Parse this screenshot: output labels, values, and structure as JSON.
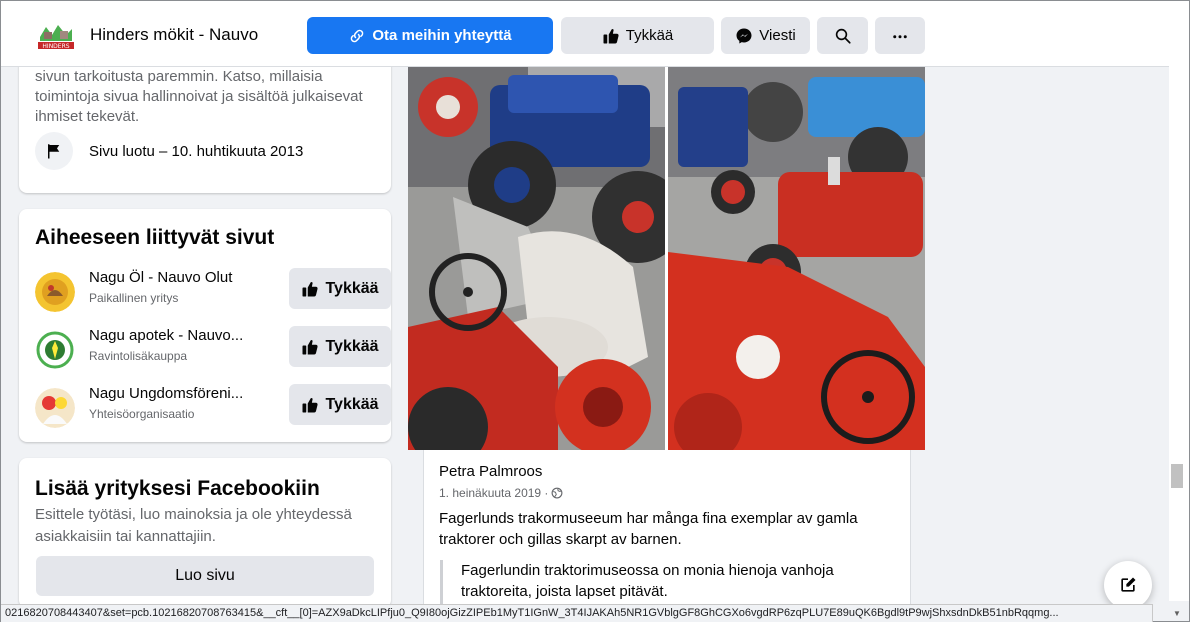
{
  "header": {
    "page_name": "Hinders mökit - Nauvo",
    "contact_label": "Ota meihin yhteyttä",
    "like_label": "Tykkää",
    "message_label": "Viesti"
  },
  "about": {
    "text": "sivun tarkoitusta paremmin. Katso, millaisia toimintoja sivua hallinnoivat ja sisältöä julkaisevat ihmiset tekevät.",
    "created": "Sivu luotu – 10. huhtikuuta 2013"
  },
  "related": {
    "title": "Aiheeseen liittyvät sivut",
    "items": [
      {
        "name": "Nagu Öl - Nauvo Olut",
        "category": "Paikallinen yritys",
        "like_label": "Tykkää"
      },
      {
        "name": "Nagu apotek - Nauvo...",
        "category": "Ravintolisäkauppa",
        "like_label": "Tykkää"
      },
      {
        "name": "Nagu Ungdomsföreni...",
        "category": "Yhteisöorganisaatio",
        "like_label": "Tykkää"
      }
    ]
  },
  "add_business": {
    "title": "Lisää yrityksesi Facebookiin",
    "description": "Esittele työtäsi, luo mainoksia ja ole yhteydessä asiakkaisiin tai kannattajiin.",
    "button_label": "Luo sivu"
  },
  "post": {
    "author": "Petra Palmroos",
    "date": "1. heinäkuuta 2019 ·",
    "text": "Fagerlunds trakormuseeum har många fina exemplar av gamla traktorer och gillas skarpt av barnen.",
    "translation": "Fagerlundin traktorimuseossa on monia hienoja vanhoja traktoreita, joista lapset pitävät."
  },
  "status_url": "0216820708443407&set=pcb.10216820708763415&__cft__[0]=AZX9aDkcLIPfju0_Q9I80ojGizZIPEb1MyT1IGnW_3T4IJAKAh5NR1GVblgGF8GhCGXo6vgdRP6zqPLU7E89uQK6Bgdl9tP9wjShxsdnDkB51nbRqqmg...",
  "colors": {
    "primary": "#1877f2",
    "background": "#f0f2f5",
    "secondary_button": "#e4e6eb",
    "tractor_red": "#d62a1e",
    "tractor_blue": "#2a5fb0"
  },
  "icons": {
    "contact": "link-icon",
    "like": "thumbs-up-icon",
    "message": "messenger-icon",
    "search": "search-icon",
    "more": "more-icon",
    "created": "flag-icon",
    "audience": "globe-icon",
    "compose": "compose-icon"
  }
}
